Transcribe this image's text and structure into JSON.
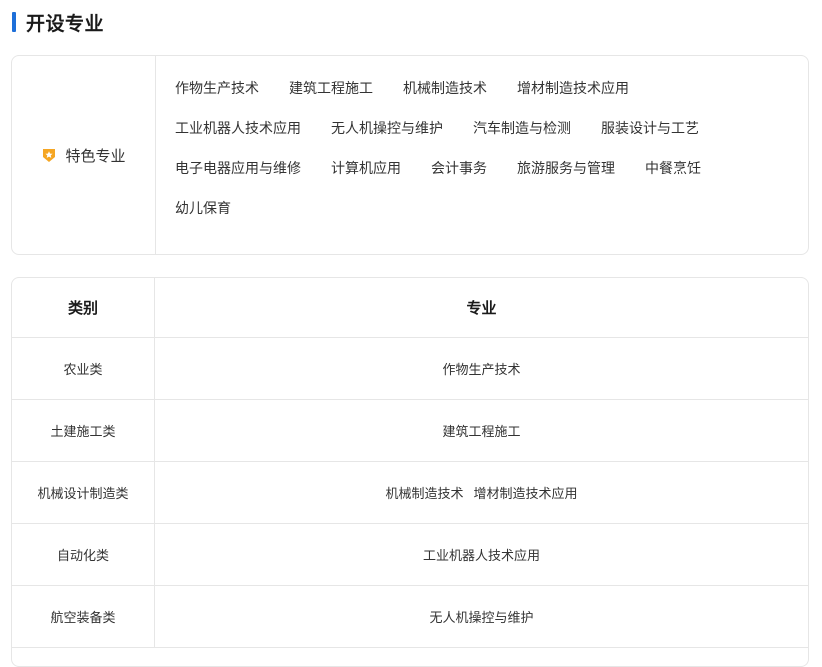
{
  "section": {
    "title": "开设专业"
  },
  "featured": {
    "label": "特色专业",
    "icon": "star-badge-icon",
    "rows": [
      [
        "作物生产技术",
        "建筑工程施工",
        "机械制造技术",
        "增材制造技术应用"
      ],
      [
        "工业机器人技术应用",
        "无人机操控与维护",
        "汽车制造与检测",
        "服装设计与工艺"
      ],
      [
        "电子电器应用与维修",
        "计算机应用",
        "会计事务",
        "旅游服务与管理",
        "中餐烹饪"
      ],
      [
        "幼儿保育"
      ]
    ]
  },
  "table": {
    "headers": {
      "category": "类别",
      "major": "专业"
    },
    "rows": [
      {
        "category": "农业类",
        "majors": [
          "作物生产技术"
        ]
      },
      {
        "category": "土建施工类",
        "majors": [
          "建筑工程施工"
        ]
      },
      {
        "category": "机械设计制造类",
        "majors": [
          "机械制造技术",
          "增材制造技术应用"
        ]
      },
      {
        "category": "自动化类",
        "majors": [
          "工业机器人技术应用"
        ]
      },
      {
        "category": "航空装备类",
        "majors": [
          "无人机操控与维护"
        ]
      }
    ]
  },
  "colors": {
    "accent": "#1e6fd9",
    "badge": "#f5a623",
    "border": "#e6e6e6"
  }
}
